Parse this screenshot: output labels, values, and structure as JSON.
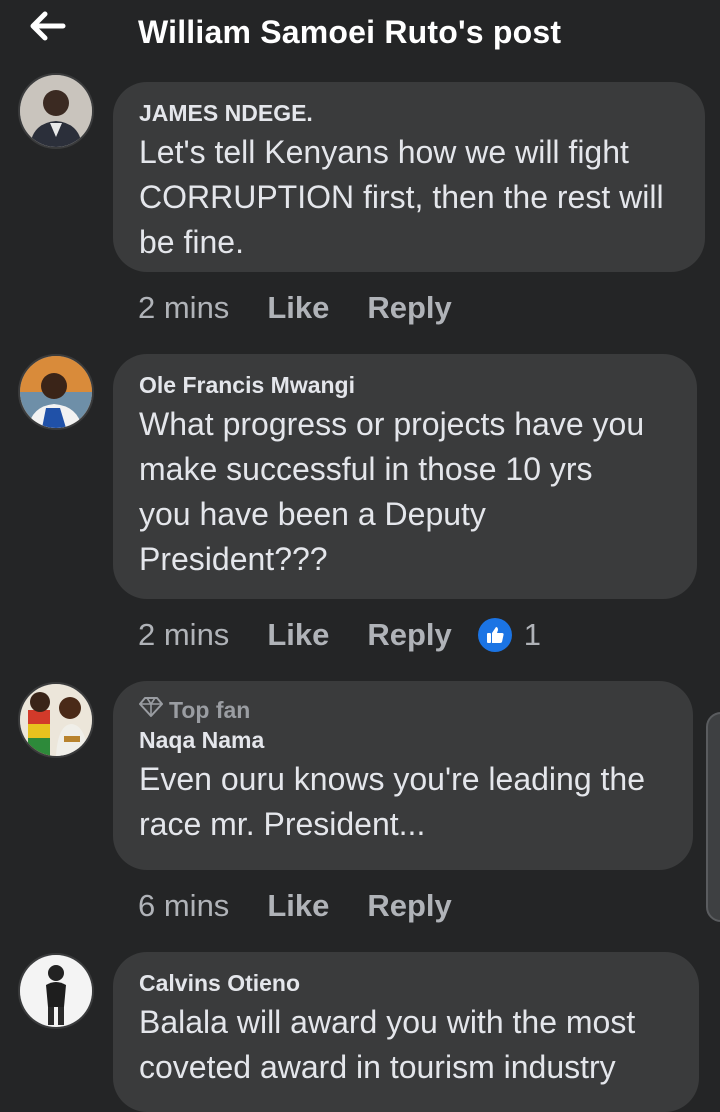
{
  "header": {
    "title": "William Samoei Ruto's post",
    "back_icon": "arrow-left-icon"
  },
  "colors": {
    "background": "#242526",
    "bubble": "#3a3b3c",
    "text": "#e4e6eb",
    "secondary_text": "#b0b3b8",
    "like_blue": "#1b74e4"
  },
  "comments": [
    {
      "author": "JAMES NDEGE.",
      "lines": [
        "Let's tell Kenyans how we will fight",
        "CORRUPTION first, then the rest will",
        "be fine."
      ],
      "time": "2 mins",
      "like": "Like",
      "reply": "Reply"
    },
    {
      "author": "Ole Francis Mwangi",
      "lines": [
        "What progress or projects have you",
        "make successful in those 10 yrs",
        "you have been a Deputy",
        "President???"
      ],
      "time": "2 mins",
      "like": "Like",
      "reply": "Reply",
      "reaction_count": "1",
      "reaction_icon": "like-thumb-icon"
    },
    {
      "badge": "Top fan",
      "badge_icon": "diamond-icon",
      "author": "Naqa Nama",
      "lines": [
        "Even ouru knows you're leading the",
        "race mr. President..."
      ],
      "time": "6 mins",
      "like": "Like",
      "reply": "Reply"
    },
    {
      "author": "Calvins Otieno",
      "lines": [
        "Balala will award you with the most",
        "coveted award in tourism industry"
      ]
    }
  ]
}
